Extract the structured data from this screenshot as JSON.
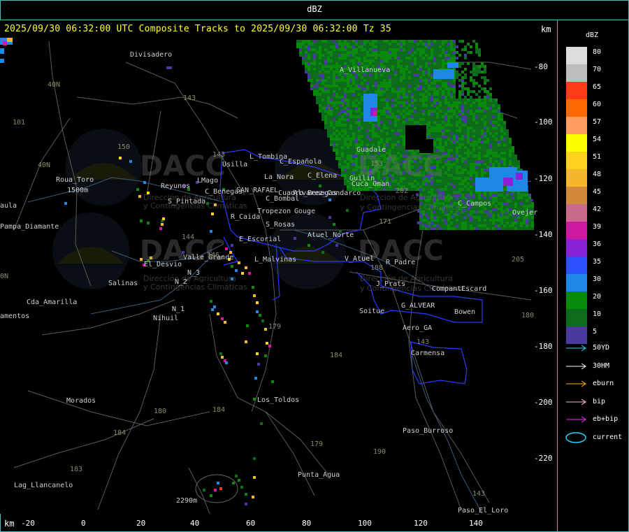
{
  "window_title": "dBZ",
  "header": "2025/09/30 06:32:00 UTC Composite Tracks to 2025/09/30 06:32:00 Tz 35",
  "km_unit": "km",
  "x_ticks": [
    "-20",
    "0",
    "20",
    "40",
    "60",
    "80",
    "100",
    "120",
    "140"
  ],
  "y_ticks": [
    "-80",
    "-100",
    "-120",
    "-140",
    "-160",
    "-180",
    "-200",
    "-220"
  ],
  "legend": {
    "title": "dBZ",
    "levels": [
      {
        "label": "80",
        "color": "#dcdcdc"
      },
      {
        "label": "70",
        "color": "#bebebe"
      },
      {
        "label": "65",
        "color": "#ff3a1a"
      },
      {
        "label": "60",
        "color": "#ff6a00"
      },
      {
        "label": "57",
        "color": "#ff9e5e"
      },
      {
        "label": "54",
        "color": "#ffff00"
      },
      {
        "label": "51",
        "color": "#ffd21e"
      },
      {
        "label": "48",
        "color": "#f5b82a"
      },
      {
        "label": "45",
        "color": "#d08a3a"
      },
      {
        "label": "42",
        "color": "#c96a8a"
      },
      {
        "label": "39",
        "color": "#d018a0"
      },
      {
        "label": "36",
        "color": "#8a22d8"
      },
      {
        "label": "35",
        "color": "#2a50ff"
      },
      {
        "label": "30",
        "color": "#1e88e8"
      },
      {
        "label": "20",
        "color": "#0a8a0a"
      },
      {
        "label": "10",
        "color": "#0c6c1c"
      },
      {
        "label": "5",
        "color": "#4a3aa0"
      }
    ]
  },
  "tracks": [
    {
      "label": "50YD",
      "color": "#22d8ff",
      "icon": "arrow-icon"
    },
    {
      "label": "30HM",
      "color": "#ffffff",
      "icon": "arrow-icon"
    },
    {
      "label": "eburn",
      "color": "#ffb020",
      "icon": "arrow-icon"
    },
    {
      "label": "bip",
      "color": "#ffc0d0",
      "icon": "arrow-icon"
    },
    {
      "label": "eb+bip",
      "color": "#ff22ff",
      "icon": "arrow-icon"
    },
    {
      "label": "current",
      "color": "#22d8ff",
      "icon": "ellipse-icon"
    }
  ],
  "places": [
    {
      "t": "Divisadero"
    },
    {
      "t": "A_Villanueva"
    },
    {
      "t": "Guadale"
    },
    {
      "t": "L_Tombina"
    },
    {
      "t": "Usilla"
    },
    {
      "t": "C_Española"
    },
    {
      "t": "Roua_Toro"
    },
    {
      "t": "1500m"
    },
    {
      "t": "Reyunos"
    },
    {
      "t": "LMago"
    },
    {
      "t": "C_Benegas"
    },
    {
      "t": "SAN_RAFAEL"
    },
    {
      "t": "La_Nora"
    },
    {
      "t": "C_Elena"
    },
    {
      "t": "Cuadro_Benegas"
    },
    {
      "t": "Guilin"
    },
    {
      "t": "Cuca_Oman"
    },
    {
      "t": "S_Pintada"
    },
    {
      "t": "C_Bombal"
    },
    {
      "t": "Alvarez_Condarco"
    },
    {
      "t": "Pampa_Diamante"
    },
    {
      "t": "aula"
    },
    {
      "t": "Tropezon"
    },
    {
      "t": "Gouge"
    },
    {
      "t": "R_Caida"
    },
    {
      "t": "S_Rosas"
    },
    {
      "t": "Atuel_Norte"
    },
    {
      "t": "E_Escorial"
    },
    {
      "t": "Valle_Grande"
    },
    {
      "t": "L_Malvinas"
    },
    {
      "t": "V_Atuel"
    },
    {
      "t": "R_Padre"
    },
    {
      "t": "El_Desvio"
    },
    {
      "t": "N_3"
    },
    {
      "t": "N_2"
    },
    {
      "t": "Salinas"
    },
    {
      "t": "J_Prats"
    },
    {
      "t": "CompantEscard"
    },
    {
      "t": "Cda_Amarilla"
    },
    {
      "t": "N_1"
    },
    {
      "t": "G_ALVEAR"
    },
    {
      "t": "Soitue"
    },
    {
      "t": "Bowen"
    },
    {
      "t": "amentos"
    },
    {
      "t": "Nihuil"
    },
    {
      "t": "Aero_GA"
    },
    {
      "t": "Carmensa"
    },
    {
      "t": "Los_Toldos"
    },
    {
      "t": "Morados"
    },
    {
      "t": "Paso_Burroso"
    },
    {
      "t": "Punta_Agua"
    },
    {
      "t": "Lag_Llancanelo"
    },
    {
      "t": "Paso_El_Loro"
    },
    {
      "t": "2290m"
    },
    {
      "t": "C_Campos"
    },
    {
      "t": "Ovejer"
    }
  ],
  "roads": [
    {
      "t": "40N"
    },
    {
      "t": "101"
    },
    {
      "t": "143"
    },
    {
      "t": "150"
    },
    {
      "t": "143"
    },
    {
      "t": "40N"
    },
    {
      "t": "153"
    },
    {
      "t": "202"
    },
    {
      "t": "171"
    },
    {
      "t": "144"
    },
    {
      "t": "146"
    },
    {
      "t": "188"
    },
    {
      "t": "179"
    },
    {
      "t": "184"
    },
    {
      "t": "143"
    },
    {
      "t": "180"
    },
    {
      "t": "184"
    },
    {
      "t": "184"
    },
    {
      "t": "179"
    },
    {
      "t": "190"
    },
    {
      "t": "183"
    },
    {
      "t": "143"
    },
    {
      "t": "205"
    },
    {
      "t": "180"
    },
    {
      "t": "0N"
    }
  ],
  "watermark": {
    "brand": "DACC",
    "line1": "Dirección de Agricultura",
    "line2": "y Contingencias Climáticas"
  }
}
